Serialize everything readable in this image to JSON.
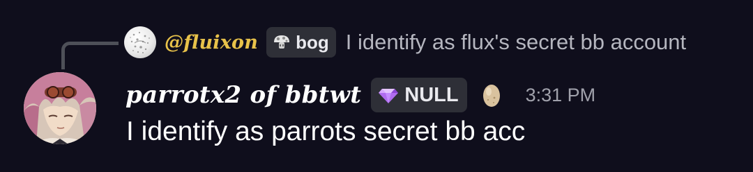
{
  "reply": {
    "avatar_icon": "reply-avatar",
    "username": "@fluixon",
    "tag": {
      "icon": "mushroom-icon",
      "label": "bog"
    },
    "preview": "I identify as flux's secret bb account"
  },
  "message": {
    "avatar_icon": "user-avatar",
    "display_name": "parrotx2 of bbtwt",
    "tag": {
      "icon": "gem-icon",
      "label": "NULL"
    },
    "badge_icon": "egg-icon",
    "timestamp": "3:31 PM",
    "content": "I identify as parrots secret bb acc"
  },
  "colors": {
    "background": "#0f0e1c",
    "reply_username": "#e8c24a",
    "tag_background": "#2e2f37",
    "timestamp": "#a0a1ab",
    "gem": "#b06cf0"
  }
}
